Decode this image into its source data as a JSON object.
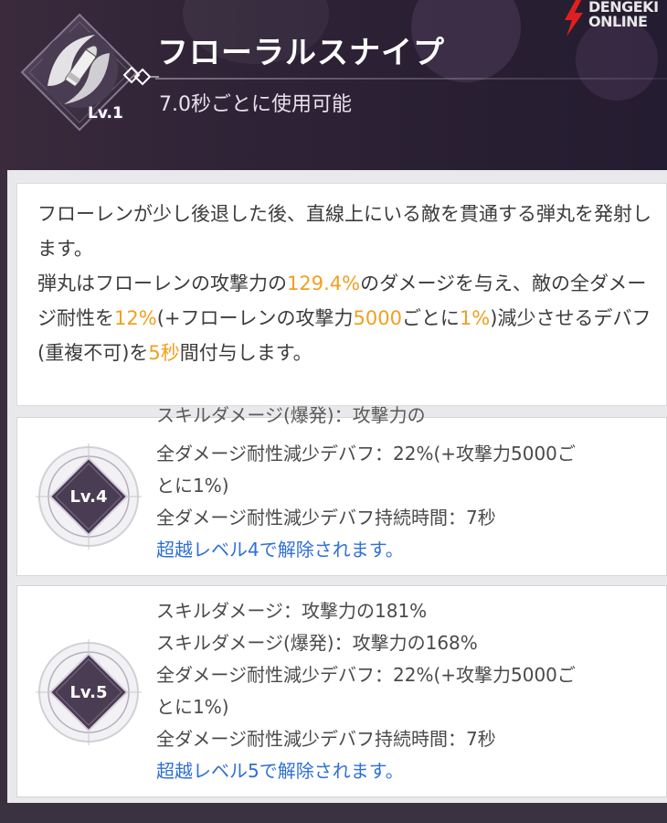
{
  "skill": {
    "name": "フローラルスナイプ",
    "level_badge": "Lv.1",
    "cooldown": "7.0秒ごとに使用可能"
  },
  "watermark": {
    "line1": "DENGEKI",
    "line2": "ONLINE"
  },
  "description": {
    "p1": "フローレンが少し後退した後、直線上にいる敵を貫通する弾丸を発射します。",
    "p2_a": "弾丸はフローレンの攻撃力の",
    "p2_val1": "129.4%",
    "p2_b": "のダメージを与え、敵の全ダメージ耐性を",
    "p2_val2": "12%",
    "p2_c": "(+フローレンの攻撃力",
    "p2_val3": "5000",
    "p2_d": "ごとに",
    "p2_val4": "1%",
    "p2_e": ")減少させるデバフ(重複不可)を",
    "p2_val5": "5秒",
    "p2_f": "間付与します。"
  },
  "levels": [
    {
      "label": "Lv.4",
      "cut_text": "スキルダメージ(爆発)：攻撃力の",
      "lines": [
        "全ダメージ耐性減少デバフ：22%(+攻撃力5000ご",
        "とに1%)",
        "全ダメージ耐性減少デバフ持続時間：7秒"
      ],
      "unlock": "超越レベル4で解除されます。"
    },
    {
      "label": "Lv.5",
      "lines": [
        "スキルダメージ：攻撃力の181%",
        "スキルダメージ(爆発)：攻撃力の168%",
        "全ダメージ耐性減少デバフ：22%(+攻撃力5000ご",
        "とに1%)",
        "全ダメージ耐性減少デバフ持続時間：7秒"
      ],
      "unlock": "超越レベル5で解除されます。"
    }
  ],
  "colors": {
    "highlight": "#f0a020",
    "unlock_text": "#2f6fd6",
    "header_bg": "#2e2236"
  },
  "icons": {
    "skill": "bullet-swirl-icon",
    "level_emblem": "diamond-emblem-icon",
    "watermark_logo": "lightning-bolt-icon"
  }
}
